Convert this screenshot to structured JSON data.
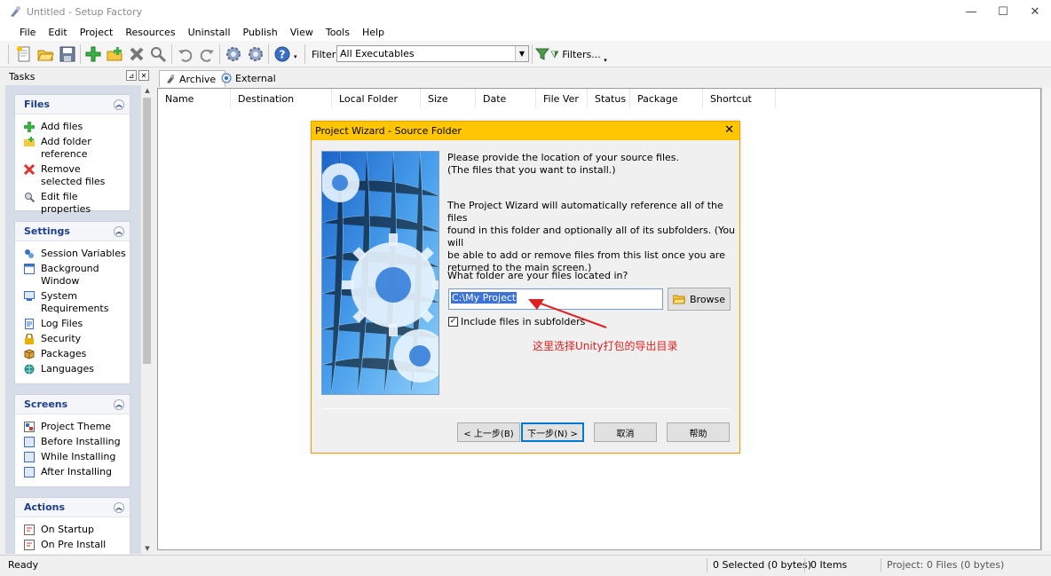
{
  "window": {
    "title": "Untitled - Setup Factory",
    "minimize": "—",
    "maximize": "☐",
    "close": "✕"
  },
  "menu": [
    "File",
    "Edit",
    "Project",
    "Resources",
    "Uninstall",
    "Publish",
    "View",
    "Tools",
    "Help"
  ],
  "toolbar": {
    "filter_label": "Filter:",
    "filter_value": "All Executables",
    "filters_button": "Filters..."
  },
  "tasks": {
    "header": "Tasks",
    "groups": [
      {
        "title": "Files",
        "items": [
          "Add files",
          "Add folder reference",
          "Remove selected files",
          "Edit file properties"
        ]
      },
      {
        "title": "Settings",
        "items": [
          "Session Variables",
          "Background Window",
          "System Requirements",
          "Log Files",
          "Security",
          "Packages",
          "Languages"
        ]
      },
      {
        "title": "Screens",
        "items": [
          "Project Theme",
          "Before Installing",
          "While Installing",
          "After Installing"
        ]
      },
      {
        "title": "Actions",
        "items": [
          "On Startup",
          "On Pre Install"
        ]
      }
    ]
  },
  "main": {
    "tabs": [
      "Archive",
      "External"
    ],
    "columns": [
      "Name",
      "Destination",
      "Local Folder",
      "Size",
      "Date",
      "File Ver",
      "Status",
      "Package",
      "Shortcut"
    ]
  },
  "dialog": {
    "title": "Project Wizard - Source Folder",
    "close": "✕",
    "intro_line1": "Please provide the location of your source files.",
    "intro_line2": "(The files that you want to install.)",
    "desc_line1": "The Project Wizard will automatically reference all of the files",
    "desc_line2": "found in this folder and optionally all of its subfolders. (You will",
    "desc_line3": "be able to add or remove files from this list once you are",
    "desc_line4": "returned to the main screen.)",
    "question": "What folder are your files located in?",
    "folder_value": "C:\\My Project",
    "browse": "Browse",
    "include_subfolders": "Include files in subfolders",
    "include_checked": "✓",
    "annotation": "这里选择Unity打包的导出目录",
    "buttons": [
      "< 上一步(B)",
      "下一步(N) >",
      "取消",
      "帮助"
    ]
  },
  "status": {
    "ready": "Ready",
    "selected": "0 Selected (0 bytes)",
    "items": "0 Items",
    "project": "Project: 0 Files (0 bytes)"
  },
  "colors": {
    "dialog_title_bg": "#ffc600",
    "task_group_title": "#1e3e8c",
    "annotation": "#e02020",
    "selection": "#3b74d6"
  }
}
